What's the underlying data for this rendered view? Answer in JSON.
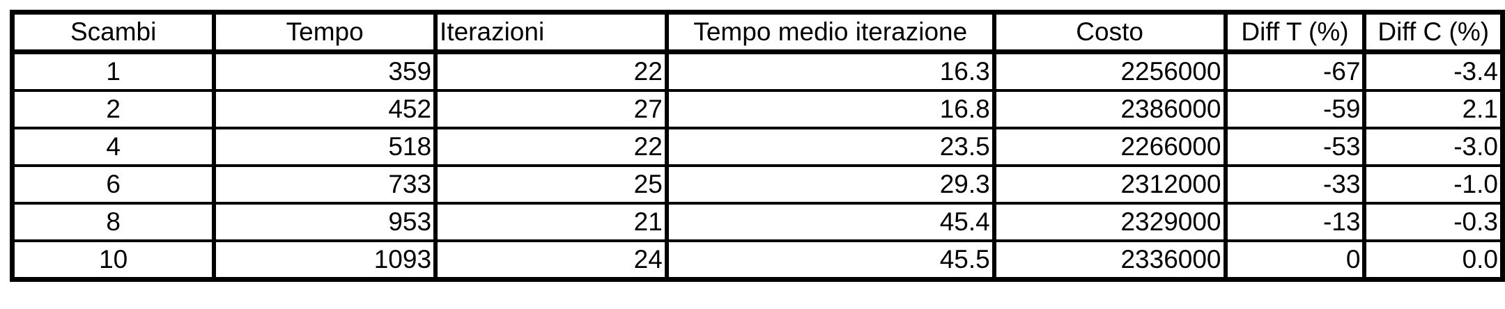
{
  "table": {
    "headers": [
      "Scambi",
      "Tempo",
      "Iterazioni",
      "Tempo medio iterazione",
      "Costo",
      "Diff T (%)",
      "Diff C (%)"
    ],
    "rows": [
      [
        "1",
        "359",
        "22",
        "16.3",
        "2256000",
        "-67",
        "-3.4"
      ],
      [
        "2",
        "452",
        "27",
        "16.8",
        "2386000",
        "-59",
        "2.1"
      ],
      [
        "4",
        "518",
        "22",
        "23.5",
        "2266000",
        "-53",
        "-3.0"
      ],
      [
        "6",
        "733",
        "25",
        "29.3",
        "2312000",
        "-33",
        "-1.0"
      ],
      [
        "8",
        "953",
        "21",
        "45.4",
        "2329000",
        "-13",
        "-0.3"
      ],
      [
        "10",
        "1093",
        "24",
        "45.5",
        "2336000",
        "0",
        "0.0"
      ]
    ]
  }
}
